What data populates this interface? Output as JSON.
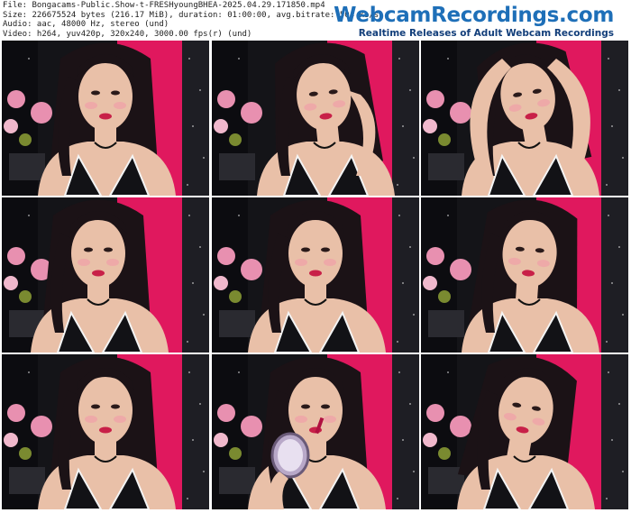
{
  "file_info": {
    "file": "File: Bongacams-Public.Show-t-FRESHyoungBHEA-2025.04.29.171850.mp4",
    "size": "Size: 226675524 bytes (216.17 MiB), duration: 01:00:00, avg.bitrate: 504 kb/s",
    "audio": "Audio: aac, 48000 Hz, stereo (und)",
    "video": "Video: h264, yuv420p, 320x240, 3000.00 fps(r) (und)"
  },
  "brand": {
    "name": "WebcamRecordings.com",
    "tagline": "Realtime Releases of Adult Webcam Recordings"
  },
  "thumbnails": [
    {
      "scene": "hair-down-facing-camera"
    },
    {
      "scene": "hand-on-forehead"
    },
    {
      "scene": "arms-raised-behind-head"
    },
    {
      "scene": "hair-swept-left"
    },
    {
      "scene": "looking-down"
    },
    {
      "scene": "smiling"
    },
    {
      "scene": "hair-down-facing-camera"
    },
    {
      "scene": "holding-mirror-applying-lipstick"
    },
    {
      "scene": "smiling-head-tilted"
    }
  ],
  "colors": {
    "background": "#ffffff",
    "curtain_pink": "#e0185e",
    "curtain_dark": "#141418",
    "skin": "#e9c0a8",
    "hair": "#1b1216",
    "top": "#121216",
    "flowers": "#e890b0",
    "brand_blue": "#1e6fb8",
    "brand_dark": "#123e7a"
  }
}
